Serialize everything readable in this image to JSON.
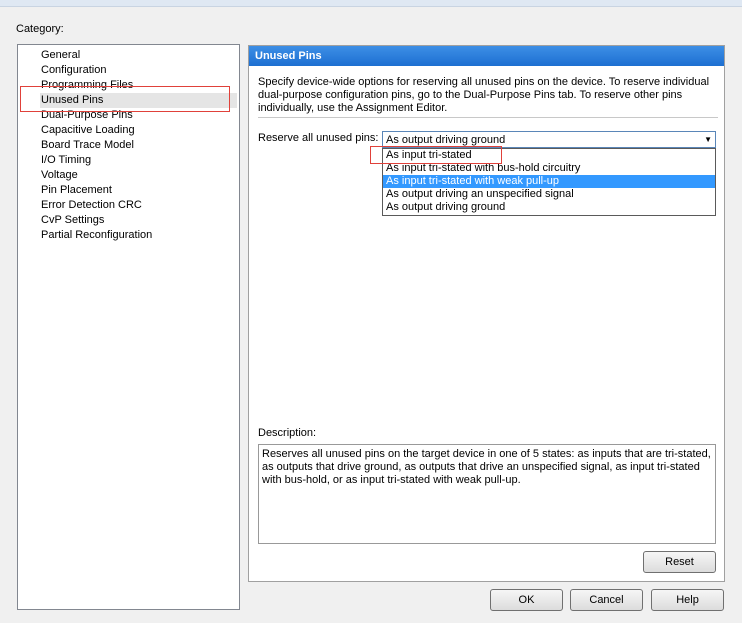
{
  "category_label": "Category:",
  "tree": {
    "items": [
      {
        "label": "General"
      },
      {
        "label": "Configuration"
      },
      {
        "label": "Programming Files"
      },
      {
        "label": "Unused Pins"
      },
      {
        "label": "Dual-Purpose Pins"
      },
      {
        "label": "Capacitive Loading"
      },
      {
        "label": "Board Trace Model"
      },
      {
        "label": "I/O Timing"
      },
      {
        "label": "Voltage"
      },
      {
        "label": "Pin Placement"
      },
      {
        "label": "Error Detection CRC"
      },
      {
        "label": "CvP Settings"
      },
      {
        "label": "Partial Reconfiguration"
      }
    ],
    "selected": "Unused Pins"
  },
  "panel": {
    "title": "Unused Pins",
    "intro": "Specify device-wide options for reserving all unused pins on the device. To reserve individual dual-purpose configuration pins, go to the Dual-Purpose Pins tab. To reserve other pins individually, use the Assignment Editor.",
    "reserve_label": "Reserve all unused pins:",
    "reserve_value": "As output driving ground",
    "dropdown_options": [
      {
        "label": "As input tri-stated"
      },
      {
        "label": "As input tri-stated with bus-hold circuitry"
      },
      {
        "label": "As input tri-stated with weak pull-up"
      },
      {
        "label": "As output driving an unspecified signal"
      },
      {
        "label": "As output driving ground"
      }
    ],
    "highlighted_option": "As input tri-stated with weak pull-up",
    "description_label": "Description:",
    "description_text": "Reserves all unused pins on the target device in one of 5 states: as inputs that are tri-stated, as outputs that drive ground, as outputs that drive an unspecified signal, as input tri-stated with bus-hold, or as input tri-stated with weak pull-up.",
    "reset_label": "Reset"
  },
  "footer": {
    "ok_label": "OK",
    "cancel_label": "Cancel",
    "help_label": "Help"
  },
  "colors": {
    "header_blue": "#1d6fd1",
    "highlight_blue": "#3399ff",
    "annotation_red": "#e0413a"
  }
}
